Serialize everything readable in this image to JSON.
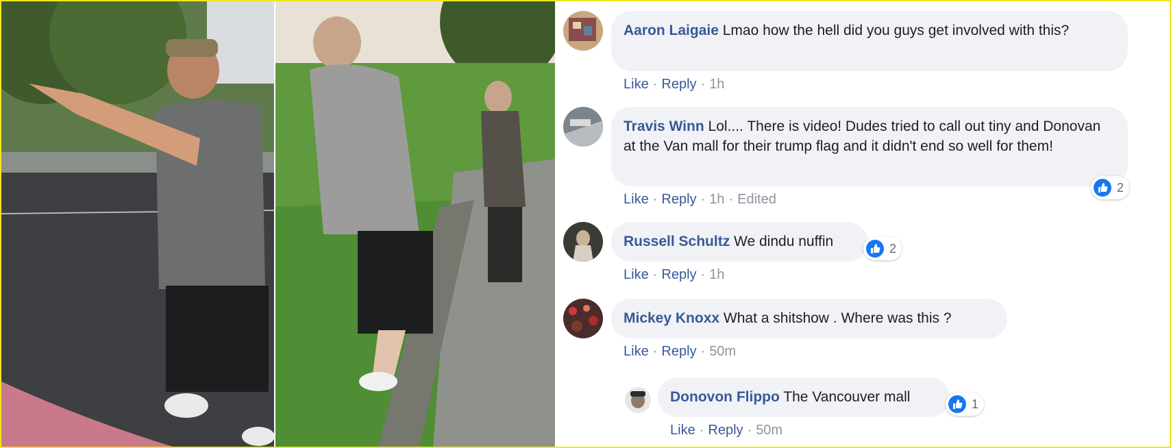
{
  "colors": {
    "link": "#385898",
    "bubble": "#f0f2f5",
    "like": "#1877f2",
    "frame": "#f2e61c"
  },
  "comments": [
    {
      "author": "Aaron Laigaie",
      "text": "Lmao how the hell did you guys get involved with this?",
      "like_label": "Like",
      "reply_label": "Reply",
      "time": "1h",
      "avatar_icon": "avatar-photo"
    },
    {
      "author": "Travis Winn",
      "text": "Lol.... There is video! Dudes tried to call out tiny and Donovan at the Van mall for their trump flag and it didn't end so well for them!",
      "like_label": "Like",
      "reply_label": "Reply",
      "time": "1h",
      "edited": "Edited",
      "reaction_count": "2",
      "reaction_icon": "thumbs-up-icon"
    },
    {
      "author": "Russell Schultz",
      "text": "We dindu nuffin",
      "like_label": "Like",
      "reply_label": "Reply",
      "time": "1h",
      "reaction_count": "2",
      "reaction_icon": "thumbs-up-icon"
    },
    {
      "author": "Mickey Knoxx",
      "text": "What a shitshow . Where was this ?",
      "like_label": "Like",
      "reply_label": "Reply",
      "time": "50m"
    },
    {
      "author": "Donovon Flippo",
      "text": "The Vancouver mall",
      "like_label": "Like",
      "reply_label": "Reply",
      "time": "50m",
      "reaction_count": "1",
      "reaction_icon": "thumbs-up-icon"
    }
  ]
}
